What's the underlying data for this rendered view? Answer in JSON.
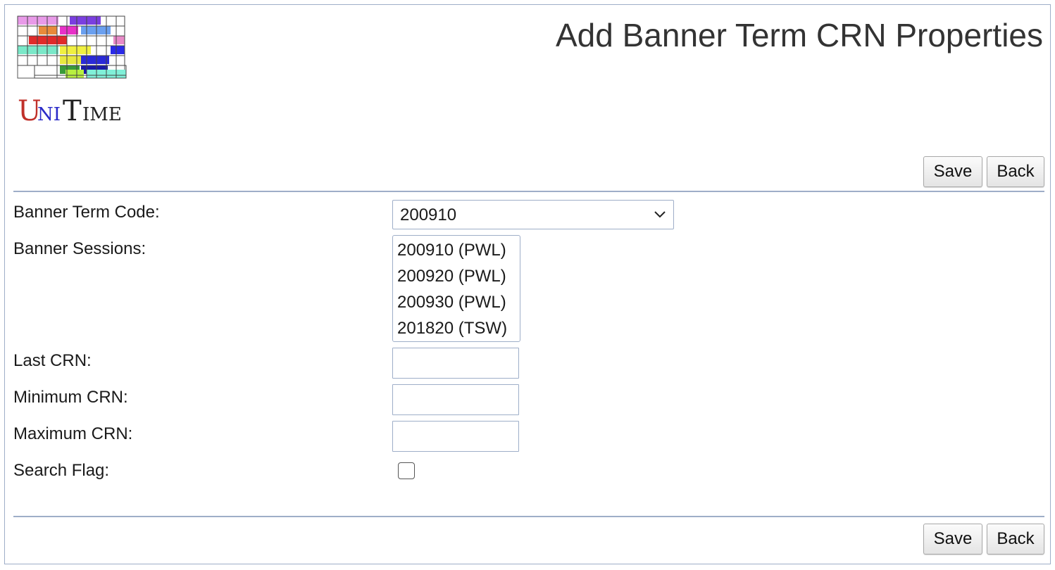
{
  "header": {
    "title": "Add Banner Term CRN Properties",
    "logo_text": "UniTime"
  },
  "toolbar_top": {
    "save_label": "Save",
    "back_label": "Back"
  },
  "toolbar_bottom": {
    "save_label": "Save",
    "back_label": "Back"
  },
  "form": {
    "term_code": {
      "label": "Banner Term Code:",
      "selected": "200910"
    },
    "sessions": {
      "label": "Banner Sessions:",
      "options": [
        "200910 (PWL)",
        "200920 (PWL)",
        "200930 (PWL)",
        "201820 (TSW)"
      ]
    },
    "last_crn": {
      "label": "Last CRN:",
      "value": ""
    },
    "min_crn": {
      "label": "Minimum CRN:",
      "value": ""
    },
    "max_crn": {
      "label": "Maximum CRN:",
      "value": ""
    },
    "search_flag": {
      "label": "Search Flag:",
      "checked": false
    }
  },
  "colors": {
    "border": "#9eaec8",
    "title_text": "#333333"
  }
}
